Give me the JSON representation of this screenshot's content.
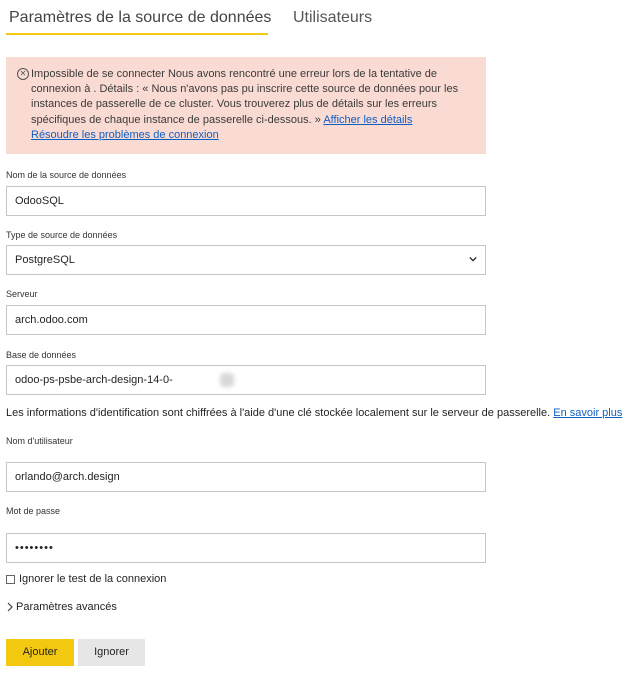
{
  "tabs": {
    "datasource_settings": "Paramètres de la source de données",
    "users": "Utilisateurs"
  },
  "error": {
    "icon": "circle-x-icon",
    "line1": "Impossible de se connecter Nous avons rencontré une erreur lors de la tentative de",
    "line2": "connexion à . Détails : « Nous n'avons pas pu inscrire cette source de données pour les",
    "line3": "instances de passerelle de ce cluster. Vous trouverez plus de détails sur les erreurs",
    "line4": "spécifiques de chaque instance de passerelle ci-dessous. »",
    "details_link": "Afficher les détails",
    "troubleshoot_link": "Résoudre les problèmes de connexion"
  },
  "form": {
    "datasource_name_label": "Nom de la source de données",
    "datasource_name_value": "OdooSQL",
    "datasource_type_label": "Type de source de données",
    "datasource_type_value": "PostgreSQL",
    "server_label": "Serveur",
    "server_value": "arch.odoo.com",
    "database_label": "Base de données",
    "database_value": "odoo-ps-psbe-arch-design-14-0-",
    "credentials_info": "Les informations d'identification sont chiffrées à l'aide d'une clé stockée localement sur le serveur de passerelle.",
    "learn_more_link": "En savoir plus",
    "username_label": "Nom d'utilisateur",
    "username_value": "orlando@arch.design",
    "password_label": "Mot de passe",
    "password_value": "••••••••",
    "skip_test_label": "Ignorer le test de la connexion",
    "skip_test_checked": false,
    "advanced_label": "Paramètres avancés"
  },
  "buttons": {
    "add": "Ajouter",
    "ignore": "Ignorer"
  },
  "colors": {
    "accent": "#f2c811",
    "error_bg": "#f9dbd3",
    "link": "#0f5ec2"
  }
}
